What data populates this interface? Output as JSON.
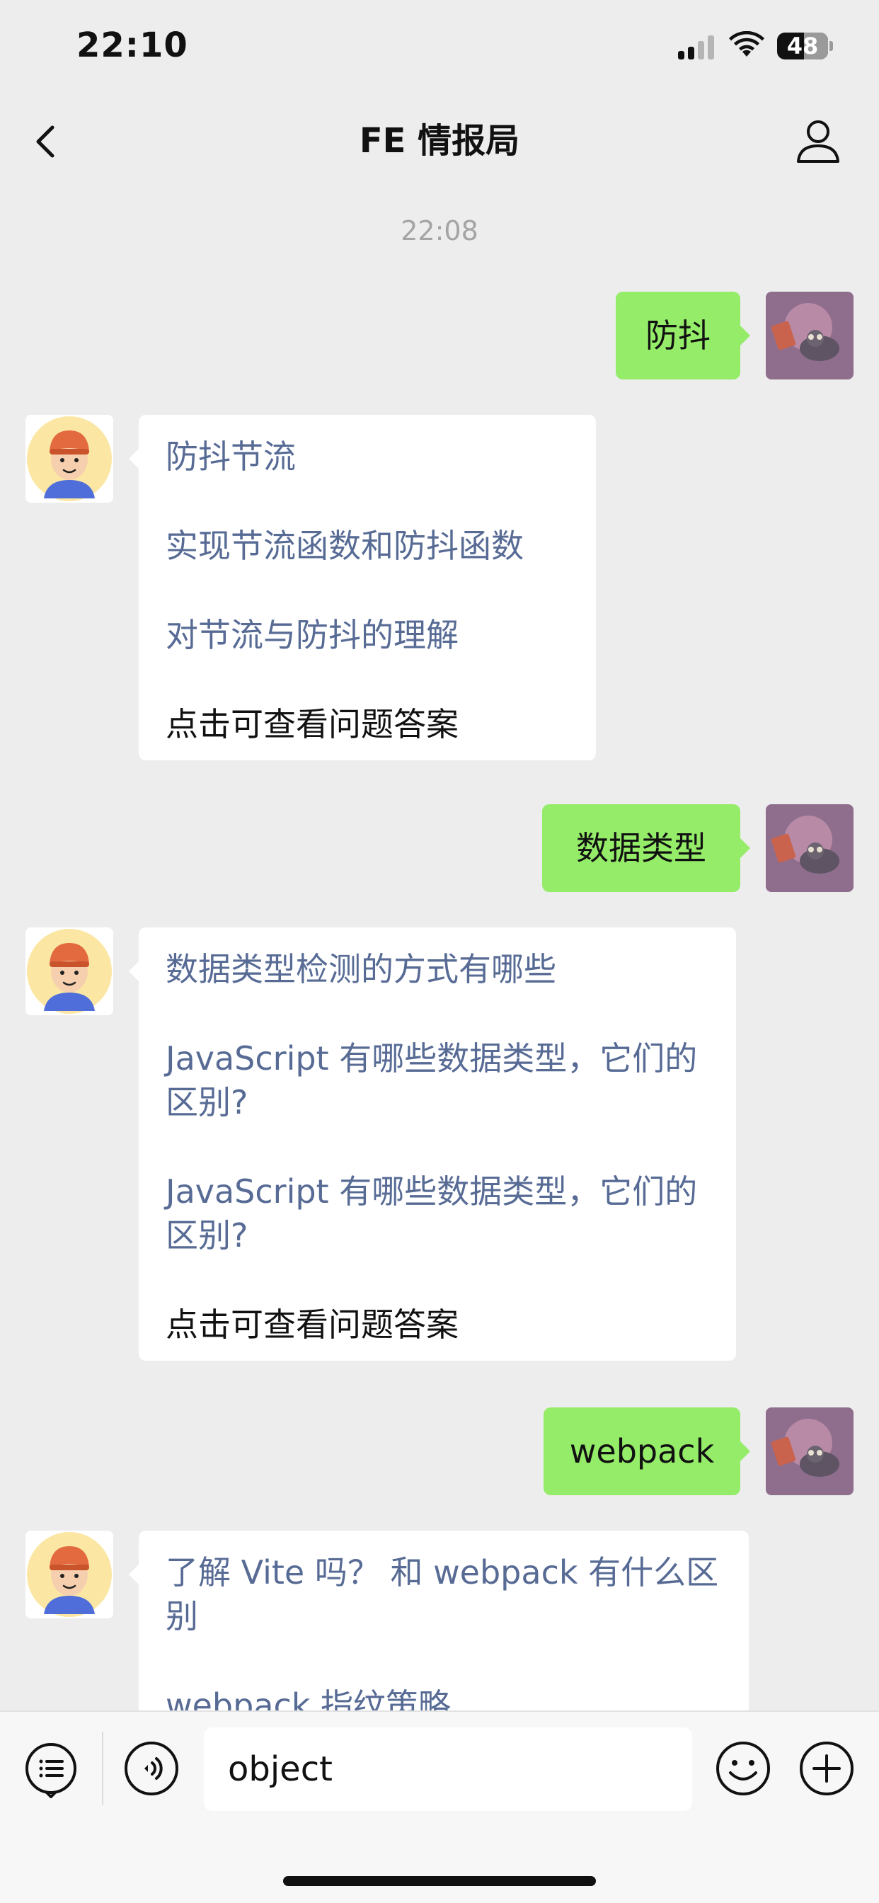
{
  "status_bar": {
    "time": "22:10",
    "battery_level": "48",
    "icons": [
      "cellular-signal-icon",
      "wifi-icon",
      "battery-icon"
    ]
  },
  "nav": {
    "title": "FE 情报局",
    "left_icon": "back-chevron-icon",
    "right_icon": "profile-icon"
  },
  "chat": {
    "timestamp": "22:08",
    "messages": [
      {
        "role": "user",
        "text": "防抖"
      },
      {
        "role": "bot",
        "questions": [
          "防抖节流",
          "实现节流函数和防抖函数",
          "对节流与防抖的理解"
        ],
        "answer_hint": "点击可查看问题答案"
      },
      {
        "role": "user",
        "text": "数据类型"
      },
      {
        "role": "bot",
        "questions": [
          "数据类型检测的方式有哪些",
          "JavaScript 有哪些数据类型，它们的区别?",
          "JavaScript 有哪些数据类型，它们的区别?"
        ],
        "answer_hint": "点击可查看问题答案"
      },
      {
        "role": "user",
        "text": "webpack"
      },
      {
        "role": "bot",
        "questions": [
          "了解 Vite 吗？ 和 webpack 有什么区别",
          "webpack 指纹策略"
        ]
      }
    ]
  },
  "input_bar": {
    "input_value": "object",
    "icons": [
      "menu-list-icon",
      "voice-icon",
      "emoji-icon",
      "plus-icon"
    ]
  },
  "colors": {
    "background": "#ededed",
    "sent_bubble": "#95ec69",
    "received_bubble": "#ffffff",
    "link_text": "#576b95",
    "timestamp": "#a4a4a4"
  }
}
